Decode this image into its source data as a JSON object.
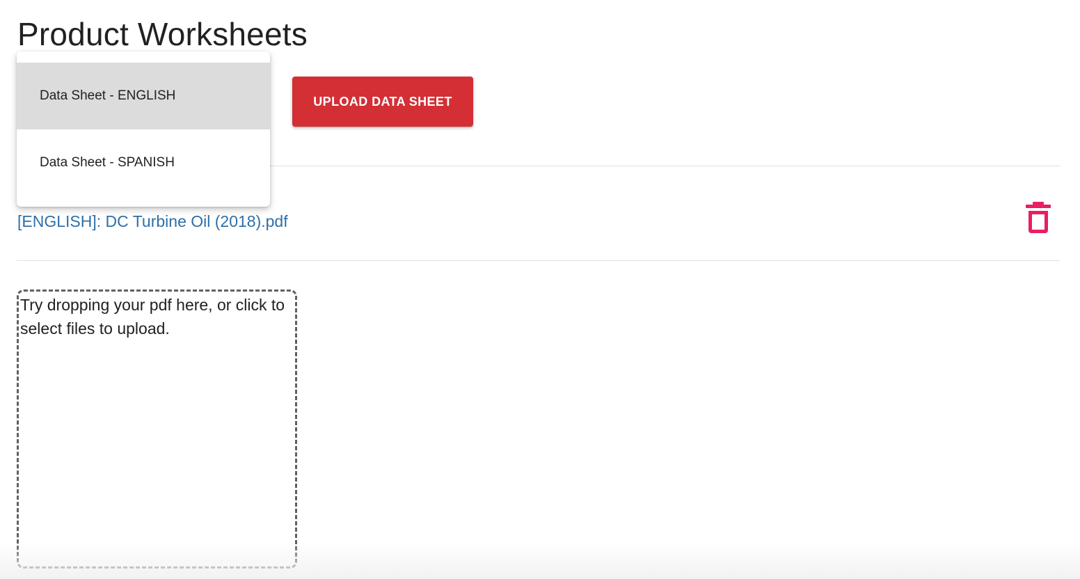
{
  "page": {
    "title": "Product Worksheets"
  },
  "toolbar": {
    "upload_label": "UPLOAD DATA SHEET"
  },
  "dropdown": {
    "items": [
      {
        "label": "Data Sheet - ENGLISH",
        "selected": true
      },
      {
        "label": "Data Sheet - SPANISH",
        "selected": false
      }
    ]
  },
  "files": [
    {
      "name": "[ENGLISH]: DC Turbine Oil (2018).pdf",
      "action_icon": "trash-icon"
    }
  ],
  "dropzone": {
    "text": "Try dropping your pdf here, or click to select files to upload."
  },
  "colors": {
    "primary_button": "#d32f35",
    "link": "#2f6fa8",
    "delete_icon": "#e91e63",
    "selected_menu_item": "#dcdcdc"
  }
}
